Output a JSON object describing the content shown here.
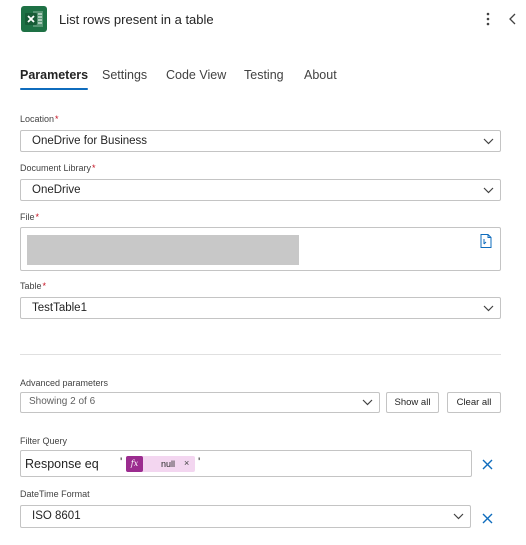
{
  "header": {
    "title": "List rows present in a table",
    "app_icon": "excel-icon",
    "more_icon": "more-vertical-icon",
    "collapse_icon": "chevron-left-icon"
  },
  "tabs": [
    {
      "label": "Parameters",
      "active": true
    },
    {
      "label": "Settings",
      "active": false
    },
    {
      "label": "Code View",
      "active": false
    },
    {
      "label": "Testing",
      "active": false
    },
    {
      "label": "About",
      "active": false
    }
  ],
  "fields": {
    "location": {
      "label": "Location",
      "required": "*",
      "value": "OneDrive for Business"
    },
    "library": {
      "label": "Document Library",
      "required": "*",
      "value": "OneDrive"
    },
    "file": {
      "label": "File",
      "required": "*"
    },
    "table": {
      "label": "Table",
      "required": "*",
      "value": "TestTable1"
    }
  },
  "advanced": {
    "label": "Advanced parameters",
    "selected": "Showing 2 of 6",
    "show_all": "Show all",
    "clear_all": "Clear all"
  },
  "filter_query": {
    "label": "Filter Query",
    "prefix": "Response eq",
    "open_quote": "'",
    "token_icon": "fx",
    "token_label": "null",
    "token_remove": "×",
    "close_quote": "'"
  },
  "datetime_format": {
    "label": "DateTime Format",
    "value": "ISO 8601"
  },
  "colors": {
    "accent": "#0f6cbd",
    "excel_green": "#1e7145",
    "token_bg": "#f3d6f0",
    "token_fx": "#9b2c8f",
    "required": "#c50f1f"
  }
}
